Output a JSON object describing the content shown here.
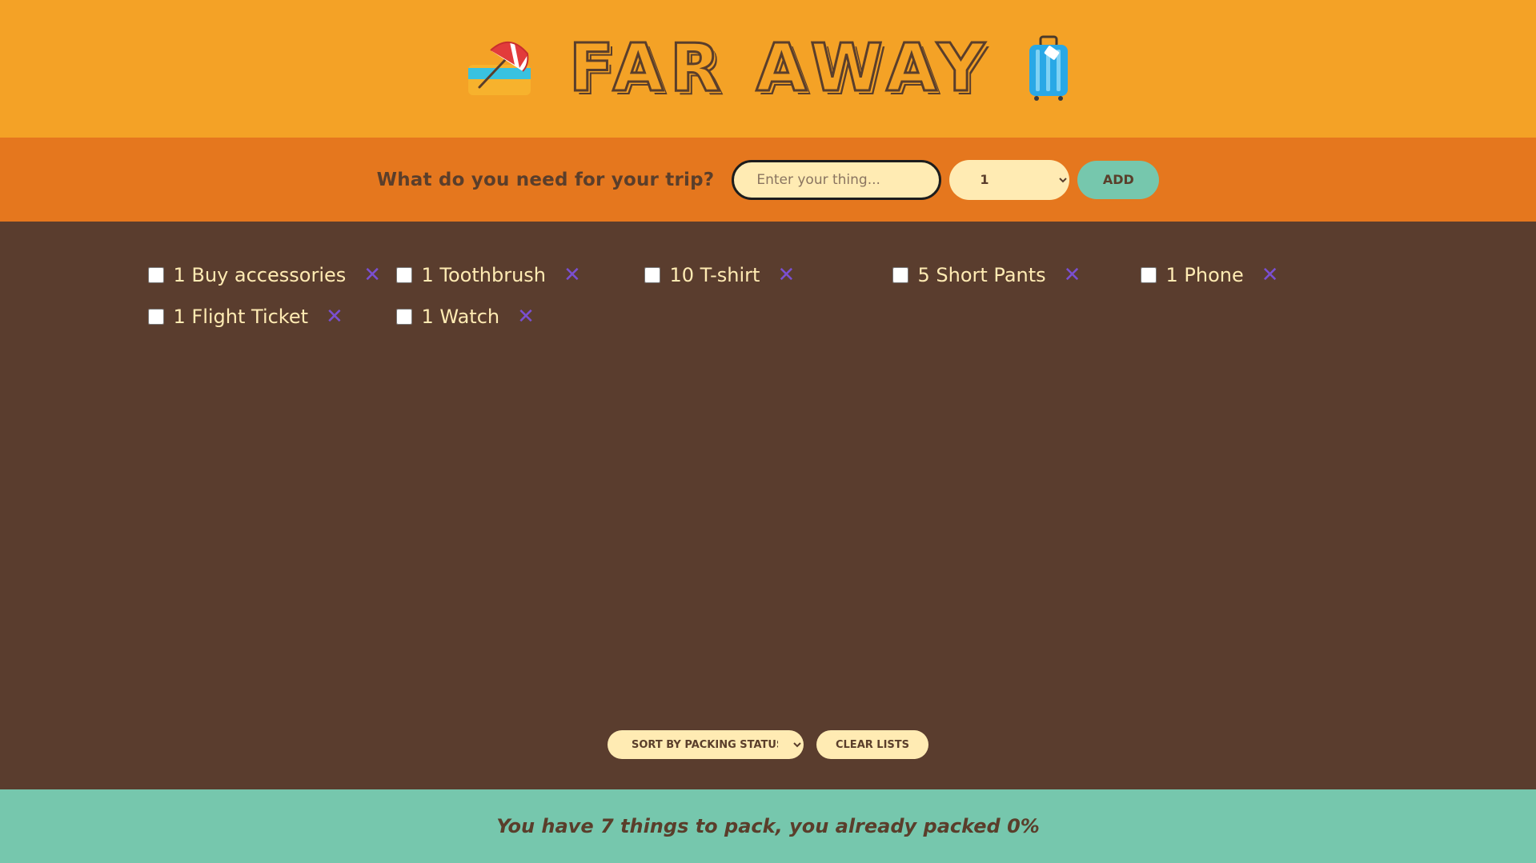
{
  "header": {
    "title": "FAR AWAY",
    "left_icon": "beach-umbrella-icon",
    "right_icon": "luggage-icon"
  },
  "form": {
    "label": "What do you need for your trip?",
    "input_placeholder": "Enter your thing...",
    "input_value": "",
    "quantity_selected": "1",
    "add_label": "ADD"
  },
  "items": [
    {
      "text": "1 Buy accessories",
      "packed": false
    },
    {
      "text": "1 Toothbrush",
      "packed": false
    },
    {
      "text": "10 T-shirt",
      "packed": false
    },
    {
      "text": "5 Short Pants",
      "packed": false
    },
    {
      "text": "1 Phone",
      "packed": false
    },
    {
      "text": "1 Flight Ticket",
      "packed": false
    },
    {
      "text": "1 Watch",
      "packed": false
    }
  ],
  "delete_glyph": "✕",
  "actions": {
    "sort_selected": "SORT BY PACKING STATUS",
    "clear_label": "CLEAR LISTS"
  },
  "stats": {
    "text": "You have 7 things to pack, you already packed 0%"
  },
  "colors": {
    "header_bg": "#f4a226",
    "form_bg": "#e5771e",
    "list_bg": "#5a3d2e",
    "stats_bg": "#76c7ad",
    "item_text": "#ffebb3",
    "delete_icon": "#7a4fd1"
  }
}
